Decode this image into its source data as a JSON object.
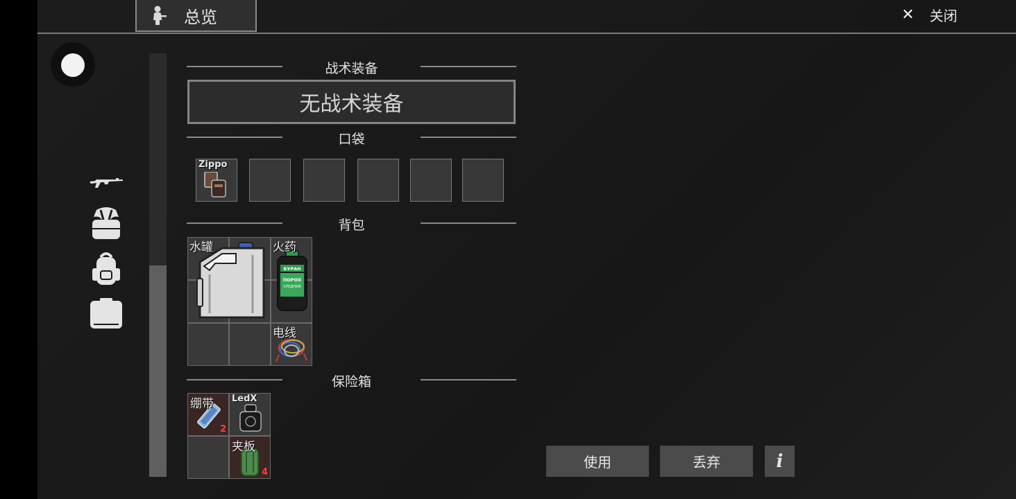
{
  "top_bar": {
    "tab_label": "总览",
    "close_label": "关闭"
  },
  "sections": {
    "tactical": "战术装备",
    "tactical_empty": "无战术装备",
    "pockets": "口袋",
    "backpack": "背包",
    "safe": "保险箱"
  },
  "pockets": [
    {
      "label": "Zippo",
      "icon": "zippo-lighter-icon"
    }
  ],
  "backpack_items": [
    {
      "label": "水罐",
      "icon": "water-jerrycan-icon"
    },
    {
      "label": "火药",
      "icon": "gunpowder-bottle-icon",
      "bottle_text": [
        "БУРАН",
        "ПОРОХ",
        "СРЕДНИЙ"
      ]
    },
    {
      "label": "电线",
      "icon": "wires-icon"
    }
  ],
  "safe_items": [
    {
      "label": "绷带",
      "icon": "bandage-icon",
      "count": "2"
    },
    {
      "label": "LedX",
      "icon": "ledx-icon"
    },
    {
      "label": "夹板",
      "icon": "splint-icon",
      "count": "4"
    }
  ],
  "actions": {
    "use": "使用",
    "drop": "丢弃",
    "info": "i"
  },
  "colors": {
    "background": "#1b1b1b",
    "panel": "#393939",
    "count_red": "#ff3b3b",
    "safe_slot": "#3a2624"
  }
}
